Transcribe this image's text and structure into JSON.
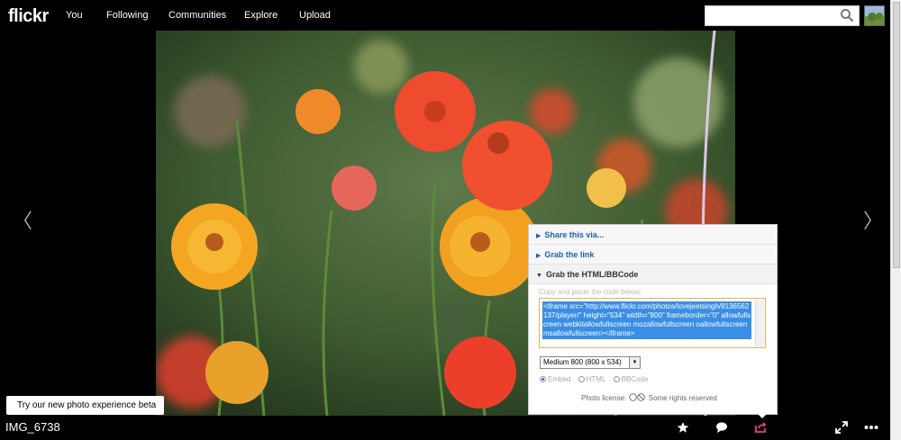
{
  "header": {
    "logo": "flickr",
    "nav": [
      "You",
      "Following",
      "Communities",
      "Explore",
      "Upload"
    ],
    "search": {
      "value": "",
      "placeholder": ""
    }
  },
  "icons": {
    "search": "search-icon",
    "prev": "chevron-left-icon",
    "next": "chevron-right-icon",
    "favorite": "star-icon",
    "comment": "comment-icon",
    "share": "share-icon",
    "fullscreen": "expand-icon",
    "more": "more-icon"
  },
  "nav_arrows": {
    "prev": "〈",
    "next": "〉"
  },
  "share": {
    "share_via": "Share this via...",
    "grab_link": "Grab the link",
    "grab_html": "Grab the HTML/BBCode",
    "copy_label": "Copy and paste the code below:",
    "code": "<iframe src=\"http://www.flickr.com/photos/lovejeetsingh/8136562137/player/\" height=\"534\" width=\"800\" frameborder=\"0\" allowfullscreen webkitallowfullscreen mozallowfullscreen oallowfullscreen msallowfullscreen></iframe>",
    "size_option": "Medium 800 (800 x 534)",
    "formats": [
      "Embed",
      "HTML",
      "BBCode"
    ],
    "selected_format": "Embed",
    "license_label": "Photo license:",
    "license_text": "Some rights reserved"
  },
  "beta_button": "Try our new photo experience beta",
  "photo_title": "IMG_6738",
  "colors": {
    "accent": "#1a5fb4",
    "share_active": "#e0408a",
    "selection": "#3a8ee6"
  }
}
